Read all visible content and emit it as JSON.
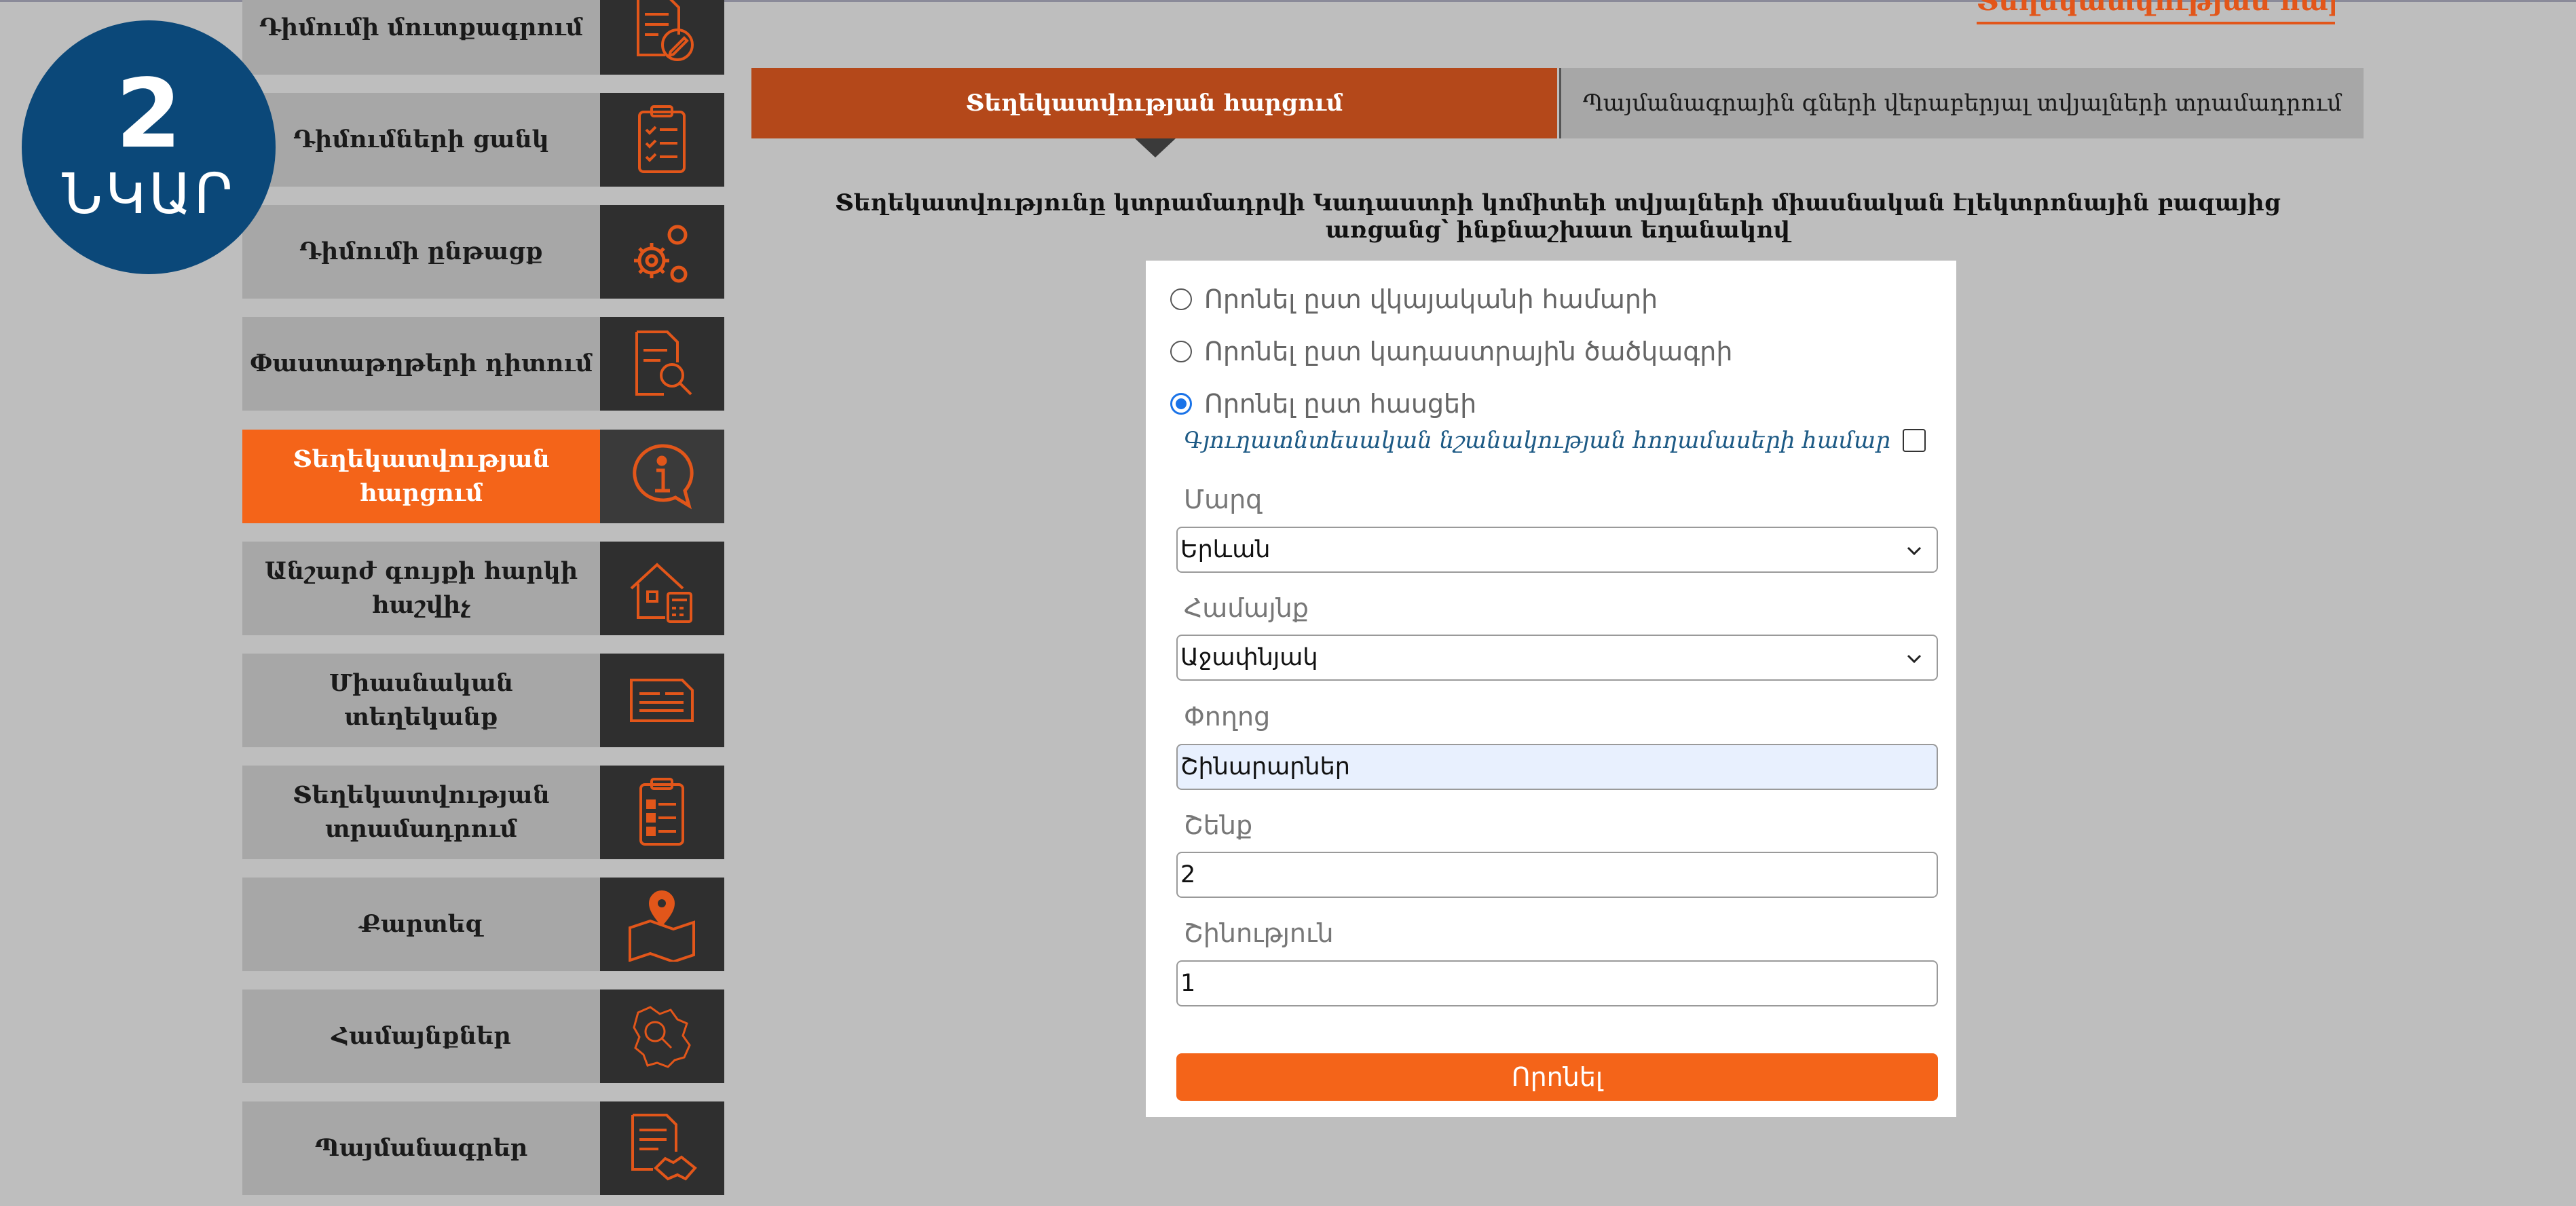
{
  "badge": {
    "number": "2",
    "word": "ՆԿԱՐ"
  },
  "top_link": "Տեղեկատվության հարցում",
  "sidebar": {
    "items": [
      {
        "label": "Դիմումի մուտքագրում",
        "icon": "document-edit-icon"
      },
      {
        "label": "Դիմումների ցանկ",
        "icon": "clipboard-list-icon"
      },
      {
        "label": "Դիմումի ընթացք",
        "icon": "gears-icon"
      },
      {
        "label": "Փաստաթղթերի դիտում",
        "icon": "document-search-icon"
      },
      {
        "label": "Տեղեկատվության հարցում",
        "icon": "info-chat-icon"
      },
      {
        "label": "Անշարժ գույքի հարկի հաշվիչ",
        "icon": "house-calculator-icon"
      },
      {
        "label": "Միասնական տեղեկանք",
        "icon": "document-lines-icon"
      },
      {
        "label": "Տեղեկատվության տրամադրում",
        "icon": "clipboard-form-icon"
      },
      {
        "label": "Քարտեզ",
        "icon": "map-pin-icon"
      },
      {
        "label": "Համայնքներ",
        "icon": "map-search-icon"
      },
      {
        "label": "Պայմանագրեր",
        "icon": "contract-handshake-icon"
      }
    ]
  },
  "tabs": [
    {
      "label": "Տեղեկատվության հարցում"
    },
    {
      "label": "Պայմանագրային գների վերաբերյալ տվյալների տրամադրում"
    }
  ],
  "intro": "Տեղեկատվությունը կտրամադրվի Կադաստրի կոմիտեի տվյալների միասնական էլեկտրոնային բազայից առցանց՝ ինքնաշխատ եղանակով",
  "search_options": [
    {
      "label": "Որոնել ըստ վկայականի համարի",
      "checked": false
    },
    {
      "label": "Որոնել ըստ կադաստրային ծածկագրի",
      "checked": false
    },
    {
      "label": "Որոնել ըստ հասցեի",
      "checked": true
    }
  ],
  "cultural_checkbox": {
    "label": "Գյուղատնտեսական նշանակության հողամասերի համար",
    "checked": false
  },
  "fields": {
    "marz": {
      "label": "Մարզ",
      "value": "Երևան"
    },
    "hamaynk": {
      "label": "Համայնք",
      "value": "Աջափնյակ"
    },
    "poghots": {
      "label": "Փողոց",
      "value": "Շինարարներ"
    },
    "shenk": {
      "label": "Շենք",
      "value": "2"
    },
    "shinutyun": {
      "label": "Շինություն",
      "value": "1"
    }
  },
  "submit_label": "Որոնել",
  "colors": {
    "accent": "#f46419",
    "tab_active": "#b4481a",
    "badge": "#0b4879",
    "sidebar_icon_bg": "#2f2f2f"
  }
}
